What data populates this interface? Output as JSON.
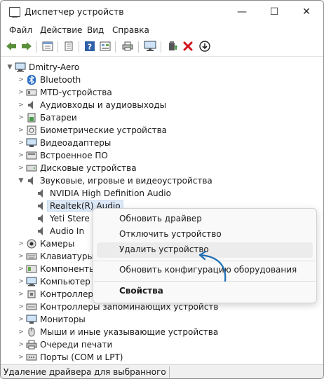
{
  "window": {
    "title": "Диспетчер устройств",
    "minimize": "—",
    "maximize": "☐",
    "close": "✕"
  },
  "menu": [
    "Файл",
    "Действие",
    "Вид",
    "Справка"
  ],
  "toolbar_icons": [
    "back-arrow-icon",
    "forward-arrow-icon",
    "properties-icon",
    "driver-icon",
    "help-icon",
    "view-icon",
    "print-icon",
    "monitor-icon",
    "update-driver-icon",
    "uninstall-icon",
    "download-icon"
  ],
  "tree": {
    "root": "Dmitry-Aero",
    "categories": [
      "Bluetooth",
      "MTD-устройства",
      "Аудиовходы и аудиовыходы",
      "Батареи",
      "Биометрические устройства",
      "Видеоадаптеры",
      "Встроенное ПО",
      "Дисковые устройства",
      "Звуковые, игровые и видеоустройства"
    ],
    "sound_children": [
      "NVIDIA High Definition Audio",
      "Realtek(R) Audio",
      "Yeti Stere",
      "Audio In"
    ],
    "categories_after": [
      "Камеры",
      "Клавиатуры",
      "Компоненть",
      "Компьютер",
      "Контроллеры",
      "Контроллеры запоминающих устройств",
      "Мониторы",
      "Мыши и иные указывающие устройства",
      "Очереди печати",
      "Порты (COM и LPT)"
    ]
  },
  "context_menu": {
    "update": "Обновить драйвер",
    "disable": "Отключить устройство",
    "uninstall": "Удалить устройство",
    "scan": "Обновить конфигурацию оборудования",
    "properties": "Свойства"
  },
  "status_bar": "Удаление драйвера для выбранного устрой",
  "colors": {
    "accent": "#1f6fb5",
    "selection": "#dde8f6",
    "close_red": "#d2141c"
  }
}
